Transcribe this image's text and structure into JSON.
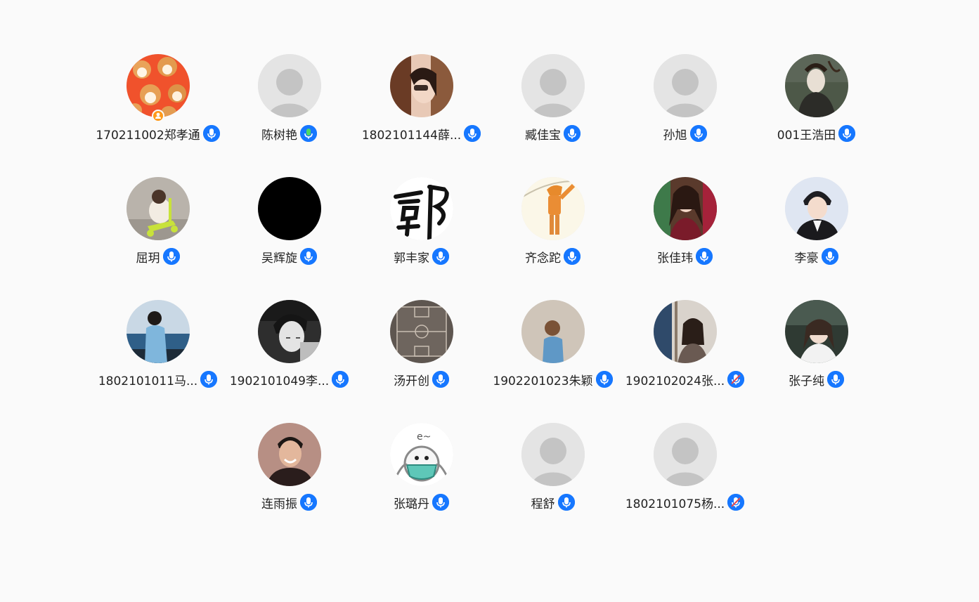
{
  "participants": [
    {
      "name": "170211002郑孝通",
      "avatar": "shiba-dogs-photo",
      "mic": "on",
      "host": true
    },
    {
      "name": "陈树艳",
      "avatar": "default-person",
      "mic": "speaking",
      "host": false
    },
    {
      "name": "1802101144薛...",
      "avatar": "girl-photo",
      "mic": "on",
      "host": false
    },
    {
      "name": "臧佳宝",
      "avatar": "default-person",
      "mic": "on",
      "host": false
    },
    {
      "name": "孙旭",
      "avatar": "default-person",
      "mic": "on",
      "host": false
    },
    {
      "name": "001王浩田",
      "avatar": "painting-photo",
      "mic": "on",
      "host": false
    },
    {
      "name": "屈玥",
      "avatar": "dog-scooter-photo",
      "mic": "on",
      "host": false
    },
    {
      "name": "吴辉旋",
      "avatar": "black-circle",
      "mic": "on",
      "host": false
    },
    {
      "name": "郭丰家",
      "avatar": "calligraphy-guo",
      "mic": "on",
      "host": false
    },
    {
      "name": "齐念跎",
      "avatar": "anime-figure-photo",
      "mic": "on",
      "host": false
    },
    {
      "name": "张佳玮",
      "avatar": "girl-long-hair-photo",
      "mic": "on",
      "host": false
    },
    {
      "name": "李豪",
      "avatar": "boy-photo",
      "mic": "on",
      "host": false
    },
    {
      "name": "1802101011马...",
      "avatar": "sea-girl-photo",
      "mic": "on",
      "host": false
    },
    {
      "name": "1902101049李...",
      "avatar": "bw-boy-photo",
      "mic": "on",
      "host": false
    },
    {
      "name": "汤开创",
      "avatar": "basketball-court-photo",
      "mic": "on",
      "host": false
    },
    {
      "name": "1902201023朱颖",
      "avatar": "child-back-photo",
      "mic": "on",
      "host": false
    },
    {
      "name": "1902102024张...",
      "avatar": "girl-window-photo",
      "mic": "muted",
      "host": false
    },
    {
      "name": "张子纯",
      "avatar": "smiling-girl-photo",
      "mic": "on",
      "host": false
    },
    {
      "name": "连雨振",
      "avatar": "smiling-man-photo",
      "mic": "on",
      "host": false
    },
    {
      "name": "张璐丹",
      "avatar": "mask-cartoon",
      "mic": "on",
      "host": false
    },
    {
      "name": "程舒",
      "avatar": "default-person",
      "mic": "on",
      "host": false
    },
    {
      "name": "1802101075杨...",
      "avatar": "default-person",
      "mic": "muted",
      "host": false
    }
  ],
  "colors": {
    "mic_blue": "#1677ff",
    "mic_speaking": "#4cd964",
    "host_badge": "#ff9a1a",
    "default_avatar_bg": "#e4e4e4",
    "default_avatar_fg": "#c4c4c4"
  }
}
